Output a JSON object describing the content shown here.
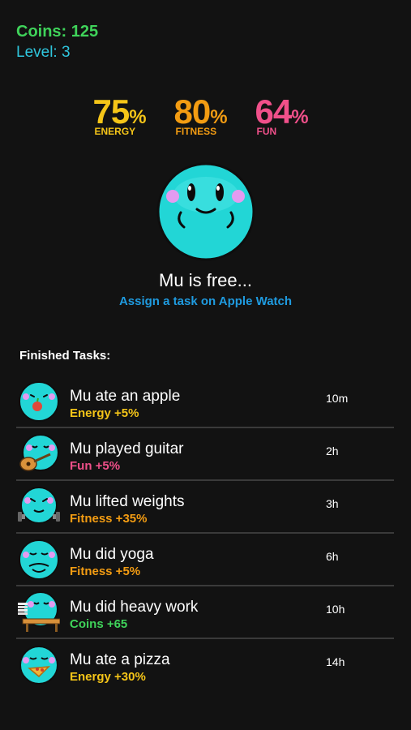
{
  "hud": {
    "coins_label": "Coins:",
    "coins_value": "125",
    "level_label": "Level:",
    "level_value": "3"
  },
  "stats": [
    {
      "value": "75",
      "unit": "%",
      "label": "ENERGY",
      "color": "#f5c518"
    },
    {
      "value": "80",
      "unit": "%",
      "label": "FITNESS",
      "color": "#f39c12"
    },
    {
      "value": "64",
      "unit": "%",
      "label": "FUN",
      "color": "#f0508a"
    }
  ],
  "status": "Mu is free...",
  "hint": "Assign a task on Apple Watch",
  "section_title": "Finished Tasks:",
  "tasks": [
    {
      "title": "Mu ate an apple",
      "effect": "Energy +5%",
      "effect_color": "#f5c518",
      "time": "10m",
      "icon": "apple-eating-icon"
    },
    {
      "title": "Mu played guitar",
      "effect": "Fun +5%",
      "effect_color": "#f0508a",
      "time": "2h",
      "icon": "guitar-icon"
    },
    {
      "title": "Mu lifted weights",
      "effect": "Fitness +35%",
      "effect_color": "#f39c12",
      "time": "3h",
      "icon": "weights-icon"
    },
    {
      "title": "Mu did yoga",
      "effect": "Fitness +5%",
      "effect_color": "#f39c12",
      "time": "6h",
      "icon": "yoga-icon"
    },
    {
      "title": "Mu did heavy work",
      "effect": "Coins +65",
      "effect_color": "#3fd35a",
      "time": "10h",
      "icon": "desk-work-icon"
    },
    {
      "title": "Mu ate a pizza",
      "effect": "Energy +30%",
      "effect_color": "#f5c518",
      "time": "14h",
      "icon": "pizza-icon"
    }
  ]
}
